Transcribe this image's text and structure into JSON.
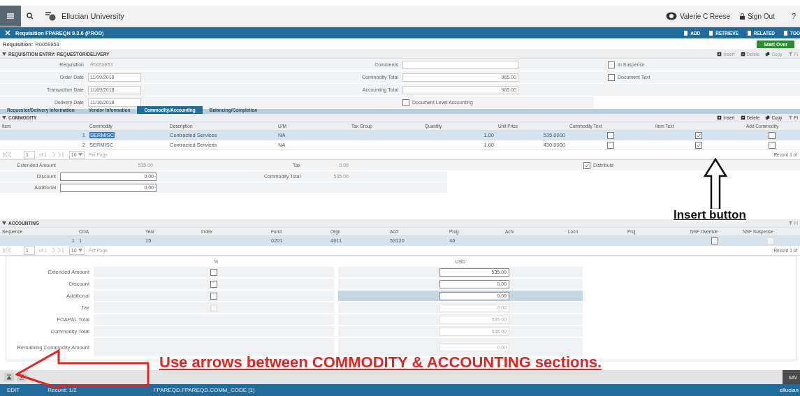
{
  "header": {
    "app_name": "Ellucian University",
    "user": "Valerie C Reese",
    "sign_out": "Sign Out",
    "help": "?"
  },
  "title_bar": {
    "title": "Requisition FPAREQN 9.3.6 (PROD)",
    "actions": [
      "ADD",
      "RETRIEVE",
      "RELATED",
      "TOO"
    ]
  },
  "key_block": {
    "label": "Requisition:",
    "value": "R0059853",
    "start_over": "Start Over"
  },
  "requisition_entry": {
    "title": "REQUISITION ENTRY: REQUESTOR/DELIVERY",
    "tools": [
      "Insert",
      "Delete",
      "Copy",
      "Fi"
    ],
    "left_fields": [
      {
        "label": "Requisition",
        "value": "R0059853",
        "disabled": true
      },
      {
        "label": "Order Date",
        "value": "11/09/2018",
        "disabled": false
      },
      {
        "label": "Transaction Date",
        "value": "11/09/2018",
        "disabled": false
      },
      {
        "label": "Delivery Date",
        "value": "11/16/2018",
        "disabled": false
      }
    ],
    "middle_fields": [
      {
        "label": "Comments"
      },
      {
        "label": "Commodity Total",
        "value": "965.00"
      },
      {
        "label": "Accounting Total",
        "value": "965.00"
      }
    ],
    "document_level_accounting": {
      "label": "Document Level Accounting",
      "checked": false
    },
    "right_checks": [
      {
        "label": "In Suspense",
        "checked": false
      },
      {
        "label": "Document Text",
        "checked": false
      }
    ]
  },
  "tabs": [
    {
      "label": "Requestor/Delivery Information",
      "selected": false
    },
    {
      "label": "Vendor Information",
      "selected": false
    },
    {
      "label": "Commodity/Accounting",
      "selected": true
    },
    {
      "label": "Balancing/Completion",
      "selected": false
    }
  ],
  "commodity": {
    "title": "COMMODITY",
    "tools": [
      "Insert",
      "Delete",
      "Copy",
      "Fi"
    ],
    "columns": [
      "Item",
      "Commodity",
      "Description",
      "U/M",
      "Tax Group",
      "Quantity",
      "Unit Price",
      "Commodity Text",
      "Item Text",
      "Add Commodity"
    ],
    "rows": [
      {
        "item": "1",
        "commodity": "SERMISC",
        "description": "Contracted Services",
        "um": "NA",
        "tax_group": "",
        "quantity": "1.00",
        "unit_price": "535.0000",
        "commodity_text": false,
        "item_text": true,
        "add_commodity": false,
        "selected": true
      },
      {
        "item": "2",
        "commodity": "SERMISC",
        "description": "Contracted Services",
        "um": "NA",
        "tax_group": "",
        "quantity": "1.00",
        "unit_price": "430.0000",
        "commodity_text": false,
        "item_text": true,
        "add_commodity": false,
        "selected": false
      }
    ],
    "pager": {
      "page": "1",
      "of": "of 1",
      "per_page_value": "10",
      "per_page": "Per Page",
      "record": "Record 1 of"
    },
    "amounts": [
      {
        "label": "Extended Amount",
        "value": "535.00",
        "editable": false
      },
      {
        "label": "Discount",
        "value": "0.00",
        "editable": true
      },
      {
        "label": "Additional",
        "value": "0.00",
        "editable": true
      }
    ],
    "totals": [
      {
        "label": "Tax",
        "value": "0.00"
      },
      {
        "label": "Commodity Total",
        "value": "535.00"
      }
    ],
    "distribute": {
      "label": "Distribute",
      "checked": true
    }
  },
  "accounting": {
    "title": "ACCOUNTING",
    "tools": [
      "Fi"
    ],
    "columns": [
      "Sequence",
      "COA",
      "Year",
      "Index",
      "Fund",
      "Orgn",
      "Acct",
      "Prog",
      "Actv",
      "Locn",
      "Proj",
      "NSF Override",
      "NSF Suspense"
    ],
    "rows": [
      {
        "sequence": "1",
        "coa": "1",
        "year": "15",
        "index": "",
        "fund": "0201",
        "orgn": "4611",
        "acct": "53120",
        "prog": "46",
        "actv": "",
        "locn": "",
        "proj": "",
        "nsf_override": false,
        "nsf_suspense": false,
        "selected": true
      }
    ],
    "pager": {
      "page": "1",
      "of": "of 1",
      "per_page_value": "10",
      "per_page": "Per Page",
      "record": "Record 1 of"
    },
    "percent_header": "%",
    "usd_header": "USD",
    "distribution": [
      {
        "label": "Extended Amount",
        "kind": "checkbox",
        "value": "535.00",
        "editable": true,
        "selected": false
      },
      {
        "label": "Discount",
        "kind": "checkbox",
        "value": "0.00",
        "editable": true,
        "selected": false
      },
      {
        "label": "Additional",
        "kind": "checkbox",
        "value": "0.00",
        "editable": true,
        "selected": true
      },
      {
        "label": "Tax",
        "kind": "disabled",
        "value": "0.00",
        "editable": false,
        "selected": false
      },
      {
        "label": "FOAPAL Total",
        "kind": "none",
        "value": "535.00",
        "editable": false,
        "selected": false
      },
      {
        "label": "Commodity Total",
        "kind": "none",
        "value": "535.00",
        "editable": false,
        "selected": false
      },
      {
        "label": "Remaining Commodity Amount",
        "kind": "none",
        "value": "0.00",
        "editable": false,
        "selected": false
      }
    ]
  },
  "bottom_bar": {
    "save": "SAV"
  },
  "status_bar": {
    "mode": "EDIT",
    "record": "Record: 1/2",
    "field": "FPAREQD.FPAREQD.COMM_CODE [1]",
    "brand": "ellucian"
  },
  "annotations": {
    "insert_note": "Insert button",
    "arrows_note": "Use arrows between COMMODITY & ACCOUNTING sections."
  }
}
